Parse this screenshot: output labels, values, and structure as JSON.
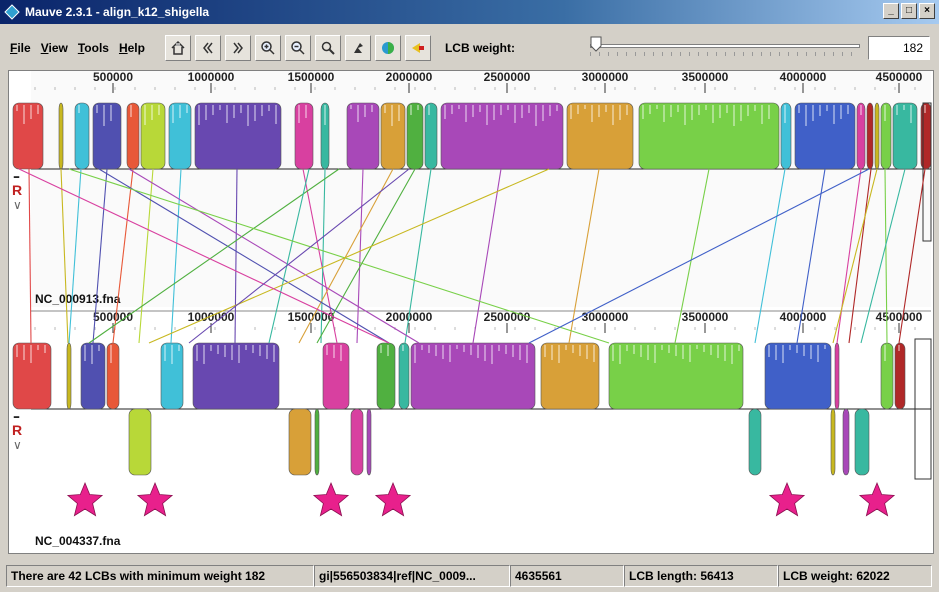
{
  "window": {
    "title": "Mauve 2.3.1 - align_k12_shigella",
    "buttons": [
      "minimize",
      "maximize",
      "close"
    ]
  },
  "menu": [
    {
      "label": "File",
      "mnemonic": "F"
    },
    {
      "label": "View",
      "mnemonic": "V"
    },
    {
      "label": "Tools",
      "mnemonic": "T"
    },
    {
      "label": "Help",
      "mnemonic": "H"
    }
  ],
  "toolbar": {
    "icons": [
      "home-icon",
      "scroll-left-icon",
      "scroll-right-icon",
      "zoom-in-icon",
      "zoom-out-icon",
      "search-icon",
      "cursor-icon",
      "color-scheme-icon",
      "back-arrow-icon"
    ],
    "lcb_weight_label": "LCB weight:",
    "lcb_weight_value": "182",
    "lcb_weight_slider_fraction": 0.0
  },
  "genomes": [
    {
      "name": "NC_000913.fna",
      "ticks": [
        "500000",
        "1000000",
        "1500000",
        "2000000",
        "2500000",
        "3000000",
        "3500000",
        "4000000",
        "4500000"
      ],
      "side_controls": {
        "up": "^",
        "minus": "–",
        "r": "R",
        "down": "∨"
      }
    },
    {
      "name": "NC_004337.fna",
      "ticks": [
        "500000",
        "1000000",
        "1500000",
        "2000000",
        "2500000",
        "3000000",
        "3500000",
        "4000000",
        "4500000"
      ],
      "side_controls": {
        "up": "^",
        "minus": "–",
        "r": "R",
        "down": "∨"
      }
    }
  ],
  "colors": {
    "red": "#e04848",
    "olive": "#c8b820",
    "cyan": "#40c0d8",
    "indigo": "#5050b0",
    "orange_red": "#e85838",
    "yellow_green": "#b8d838",
    "purple": "#6848b0",
    "magenta": "#d840a0",
    "green": "#50b040",
    "teal": "#38b8a0",
    "violet": "#a848b8",
    "gold": "#d8a038",
    "bright_green": "#78d048",
    "blue": "#4060c8",
    "dark_red": "#b02828",
    "star": "#e8208c"
  },
  "status": {
    "message": "There are 42 LCBs with minimum weight 182",
    "sequence": "gi|556503834|ref|NC_0009...",
    "position": "4635561",
    "lcb_length": "LCB length: 56413",
    "lcb_weight": "LCB weight: 62022"
  }
}
